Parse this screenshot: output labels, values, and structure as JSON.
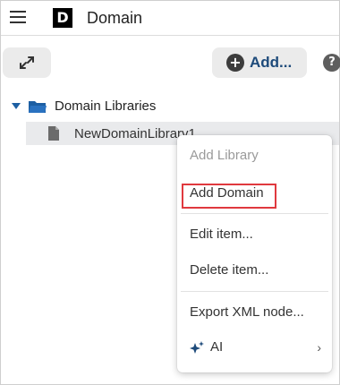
{
  "header": {
    "logo_letter": "D",
    "title": "Domain"
  },
  "toolbar": {
    "add_label": "Add...",
    "help_label": "?"
  },
  "tree": {
    "root_label": "Domain Libraries",
    "children": [
      {
        "label": "NewDomainLibrary1"
      }
    ]
  },
  "context_menu": {
    "items": [
      {
        "label": "Add Library",
        "enabled": false
      },
      {
        "label": "Add Domain",
        "enabled": true,
        "highlighted": true
      },
      {
        "label": "Edit item...",
        "enabled": true
      },
      {
        "label": "Delete item...",
        "enabled": true
      },
      {
        "label": "Export XML node...",
        "enabled": true
      },
      {
        "label": "AI",
        "enabled": true,
        "submenu": true,
        "chevron": "›"
      }
    ]
  },
  "colors": {
    "accent": "#1d5fa3",
    "highlight_box": "#e0393e",
    "selected_row": "#e9eaec"
  },
  "icons": [
    "hamburger-menu-icon",
    "expand-icon",
    "plus-circle-icon",
    "help-icon",
    "caret-down-icon",
    "folder-icon",
    "document-icon",
    "ai-sparkle-icon",
    "chevron-right-icon"
  ]
}
